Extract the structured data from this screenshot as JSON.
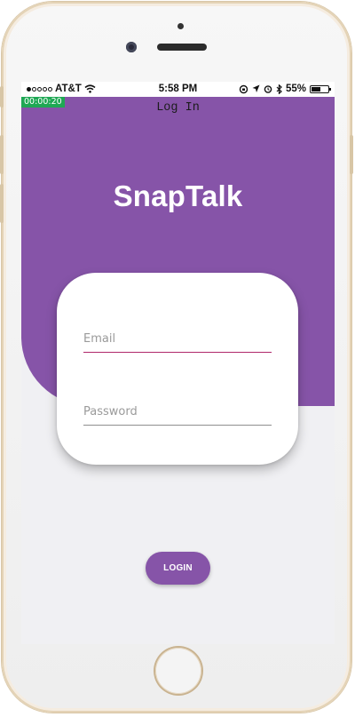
{
  "status_bar": {
    "carrier": "AT&T",
    "time": "5:58 PM",
    "battery": "55%",
    "battery_level": 0.55
  },
  "timer": "00:00:20",
  "nav": {
    "title": "Log In"
  },
  "app": {
    "name": "SnapTalk"
  },
  "form": {
    "email_placeholder": "Email",
    "password_placeholder": "Password",
    "email_value": "",
    "password_value": ""
  },
  "actions": {
    "login_label": "LOGIN"
  },
  "colors": {
    "primary": "#8654a8",
    "accent_underline": "#b0276a",
    "screen_background": "#f0f0f3",
    "timer_badge": "#1fa854"
  },
  "icons": [
    "wifi-icon",
    "screen-lock-icon",
    "location-arrow-icon",
    "alarm-icon",
    "bluetooth-icon",
    "battery-icon"
  ]
}
